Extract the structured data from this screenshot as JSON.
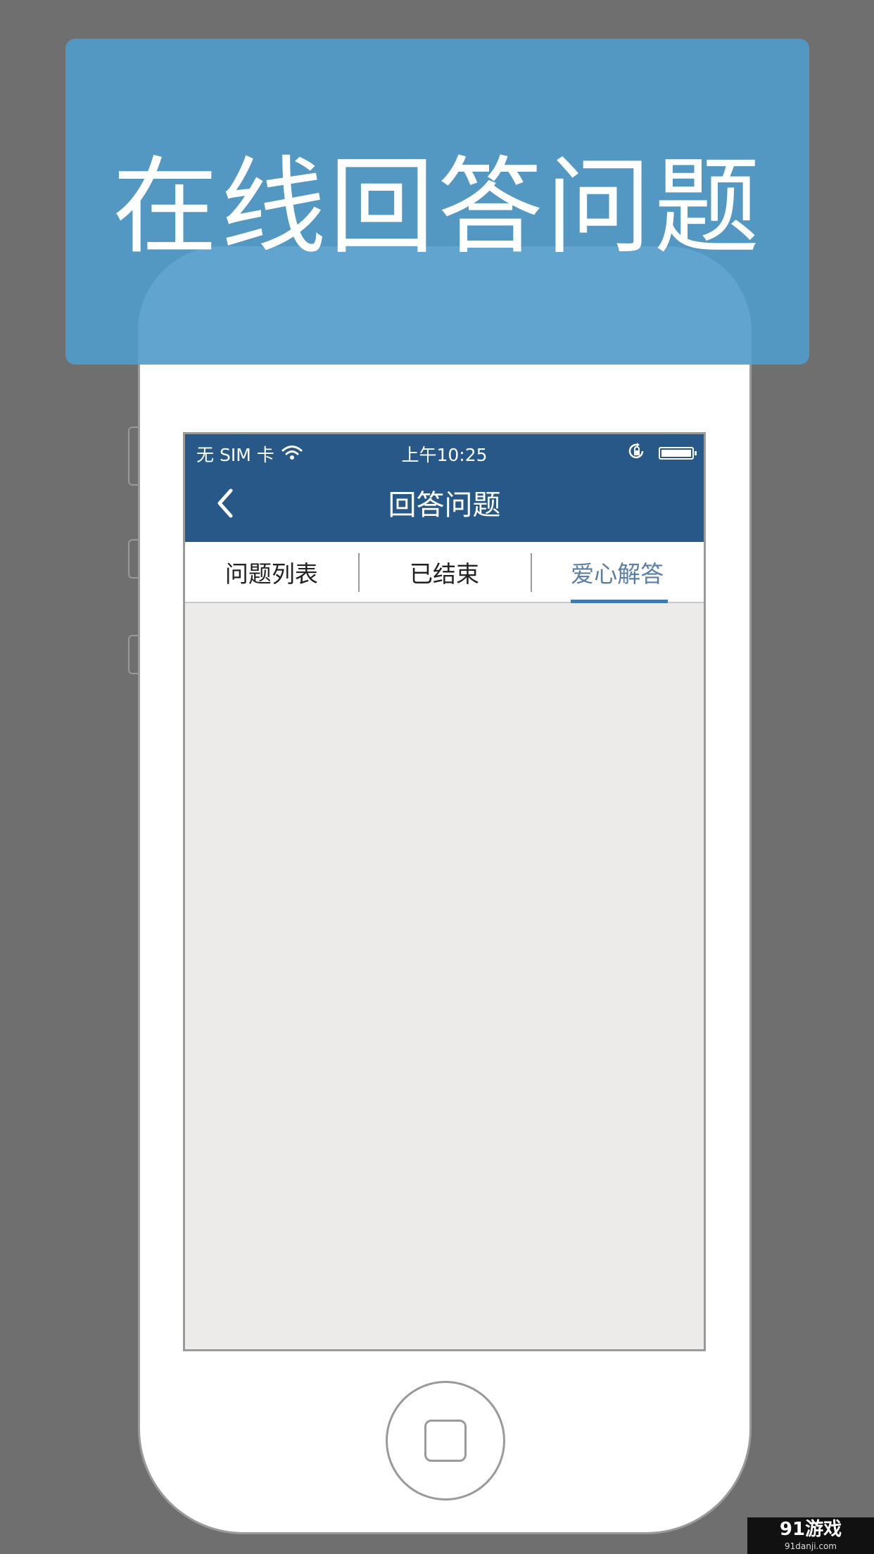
{
  "banner": {
    "title": "在线回答问题"
  },
  "status_bar": {
    "carrier": "无 SIM 卡",
    "time": "上午10:25",
    "icons": [
      "wifi-icon",
      "orientation-lock-icon",
      "battery-icon"
    ]
  },
  "nav": {
    "title": "回答问题",
    "back_icon": "chevron-left-icon"
  },
  "tabs": [
    {
      "label": "问题列表",
      "active": false
    },
    {
      "label": "已结束",
      "active": false
    },
    {
      "label": "爱心解答",
      "active": true
    }
  ],
  "watermark": {
    "brand": "91游戏",
    "url": "91danji.com"
  },
  "colors": {
    "nav_bg": "#285887",
    "banner_bg": "#5398c3",
    "active_tab": "#5a7fa7",
    "content_bg": "#ecebe9"
  }
}
